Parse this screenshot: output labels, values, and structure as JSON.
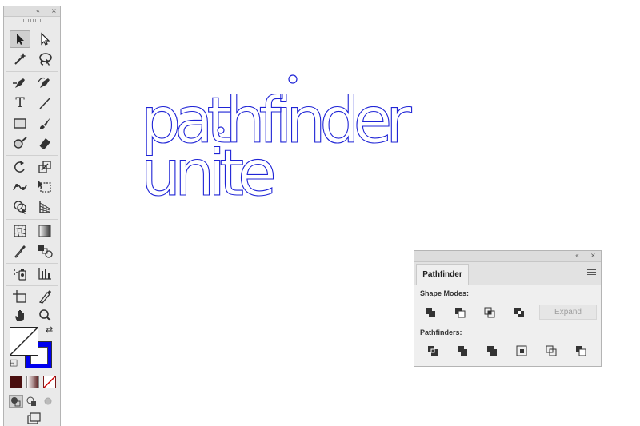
{
  "tools_panel": {
    "collapse_icon": "«",
    "close_icon": "×",
    "tools": [
      "selection-tool",
      "direct-selection-tool",
      "magic-wand-tool",
      "lasso-tool",
      "pen-tool",
      "curvature-tool",
      "type-tool",
      "line-segment-tool",
      "rectangle-tool",
      "paintbrush-tool",
      "shaper-tool",
      "eraser-tool",
      "rotate-tool",
      "scale-tool",
      "puppet-warp-tool",
      "free-transform-tool",
      "shape-builder-tool",
      "perspective-grid-tool",
      "mesh-tool",
      "gradient-tool",
      "eyedropper-tool",
      "blend-tool",
      "symbol-sprayer-tool",
      "column-graph-tool",
      "artboard-tool",
      "slice-tool",
      "hand-tool",
      "zoom-tool"
    ],
    "type_glyph": "T",
    "swap_icon": "⇄",
    "default_colors_icon": "◱",
    "fill_color": "none",
    "stroke_color": "#0000ee",
    "color_mode_colors": [
      "#4a0f0f",
      "gradient",
      "none"
    ]
  },
  "artwork": {
    "line1": "pathfinder",
    "line2": "unite",
    "stroke_color": "#1f24d6"
  },
  "pathfinder_panel": {
    "collapse_icon": "«",
    "close_icon": "×",
    "tab_label": "Pathfinder",
    "shape_modes_label": "Shape Modes:",
    "pathfinders_label": "Pathfinders:",
    "expand_label": "Expand",
    "shape_modes": [
      "unite",
      "minus-front",
      "intersect",
      "exclude"
    ],
    "pathfinders": [
      "divide",
      "trim",
      "merge",
      "crop",
      "outline",
      "minus-back"
    ]
  }
}
